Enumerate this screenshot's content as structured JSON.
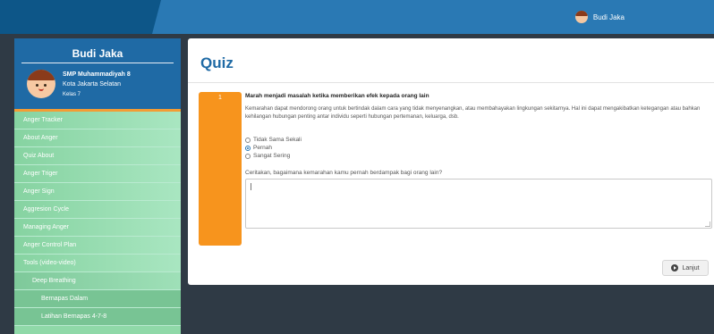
{
  "header": {
    "user_name": "Budi Jaka"
  },
  "profile": {
    "name": "Budi Jaka",
    "school": "SMP Muhammadiyah 8",
    "city": "Kota Jakarta Selatan",
    "grade": "Kelas 7"
  },
  "sidebar": {
    "items": [
      {
        "label": "Anger Tracker",
        "level": 0
      },
      {
        "label": "About Anger",
        "level": 0
      },
      {
        "label": "Quiz About",
        "level": 0
      },
      {
        "label": "Anger Triger",
        "level": 0
      },
      {
        "label": "Anger Sign",
        "level": 0
      },
      {
        "label": "Aggresion Cycle",
        "level": 0
      },
      {
        "label": "Managing Anger",
        "level": 0
      },
      {
        "label": "Anger Control Plan",
        "level": 0
      },
      {
        "label": "Tools (video-video)",
        "level": 0
      },
      {
        "label": "Deep Breathing",
        "level": 1
      },
      {
        "label": "Bernapas Dalam",
        "level": 2
      },
      {
        "label": "Latihan Bernapas 4-7-8",
        "level": 2
      }
    ]
  },
  "main": {
    "title": "Quiz",
    "question": {
      "number": "1",
      "title": "Marah menjadi masalah ketika memberikan efek kepada orang lain",
      "description": "Kemarahan dapat mendorong orang untuk bertindak dalam cara yang tidak menyenangkan, atau membahayakan lingkungan sekitarnya. Hal ini dapat mengakibatkan ketegangan atau bahkan kehilangan hubungan penting antar individu seperti hubungan pertemanan, keluarga, dsb.",
      "options": [
        {
          "label": "Tidak Sama Sekali",
          "selected": false
        },
        {
          "label": "Pernah",
          "selected": true
        },
        {
          "label": "Sangat Sering",
          "selected": false
        }
      ],
      "prompt": "Ceritakan, bagaimana kemarahan kamu pernah berdampak bagi orang lain?",
      "answer_value": ""
    },
    "next_label": "Lanjut"
  },
  "colors": {
    "primary": "#2a79b4",
    "accent": "#f7941d",
    "sidebar": "#8fd9a8"
  }
}
